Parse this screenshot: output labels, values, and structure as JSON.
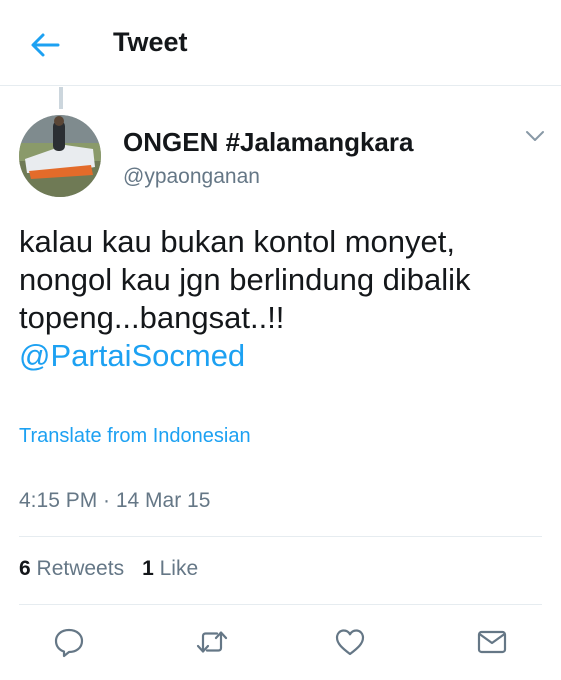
{
  "header": {
    "title": "Tweet",
    "back_icon": "arrow-left-icon"
  },
  "tweet": {
    "display_name": "ONGEN #Jalamangkara",
    "handle": "@ypaonganan",
    "text_lines": [
      "kalau kau bukan kontol monyet,",
      "nongol kau jgn berlindung dibalik",
      "topeng...bangsat..!!"
    ],
    "mention": "@PartaiSocmed",
    "translate_label": "Translate from Indonesian",
    "timestamp": "4:15 PM · 14 Mar 15"
  },
  "stats": {
    "retweets_count": "6",
    "retweets_label": "Retweets",
    "likes_count": "1",
    "likes_label": "Like"
  },
  "actions": [
    "reply-icon",
    "retweet-icon",
    "like-icon",
    "share-icon"
  ],
  "colors": {
    "accent": "#1da1f2",
    "text": "#14171a",
    "secondary": "#657786",
    "divider": "#e6ecf0"
  }
}
